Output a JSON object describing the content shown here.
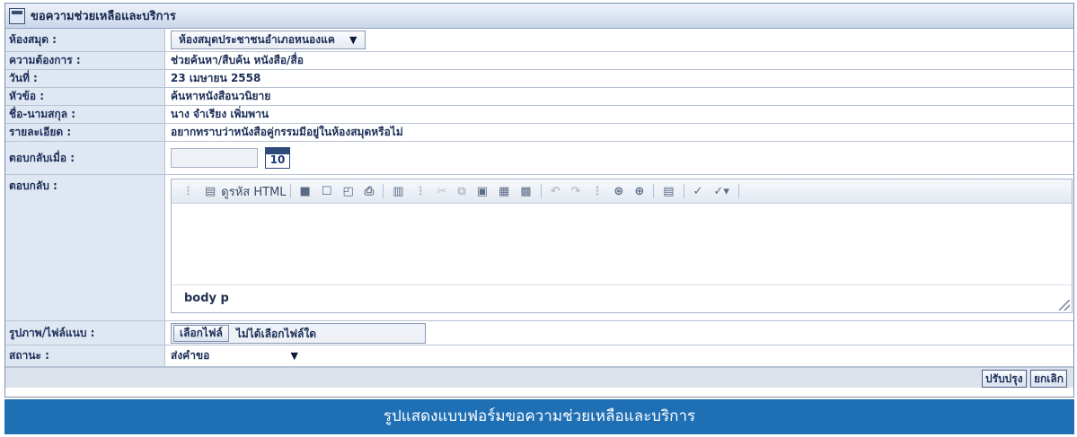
{
  "window": {
    "title": "ขอความช่วยเหลือและบริการ",
    "icon": "form-window-icon"
  },
  "form": {
    "library": {
      "label": "ห้องสมุด :",
      "value": "ห้องสมุดประชาชนอำเภอหนองแค"
    },
    "need": {
      "label": "ความต้องการ :",
      "value": "ช่วยค้นหา/สืบค้น หนังสือ/สื่อ"
    },
    "date": {
      "label": "วันที่ :",
      "value": "23 เมษายน 2558"
    },
    "subject": {
      "label": "หัวข้อ :",
      "value": "ค้นหาหนังสือนวนิยาย"
    },
    "name": {
      "label": "ชื่อ-นามสกุล :",
      "value": "นาง จำเรียง เพิ่มพาน"
    },
    "detail": {
      "label": "รายละเอียด :",
      "value": "อยากทราบว่าหนังสือคู่กรรมมีอยู่ในห้องสมุดหรือไม่"
    },
    "reply_when": {
      "label": "ตอบกลับเมื่อ :",
      "value": "",
      "calendar_day": "10"
    },
    "reply": {
      "label": "ตอบกลับ :",
      "editor_html_label": "ดูรหัส HTML",
      "path": "body  p"
    },
    "attachment": {
      "label": "รูปภาพ/ไฟล์แนบ :",
      "button": "เลือกไฟล์",
      "status": "ไม่ได้เลือกไฟล์ใด"
    },
    "status": {
      "label": "สถานะ :",
      "value": "ส่งคำขอ"
    }
  },
  "buttons": {
    "update": "ปรับปรุง",
    "cancel": "ยกเลิก"
  },
  "caption": "รูปแสดงแบบฟอร์มขอความช่วยเหลือและบริการ"
}
